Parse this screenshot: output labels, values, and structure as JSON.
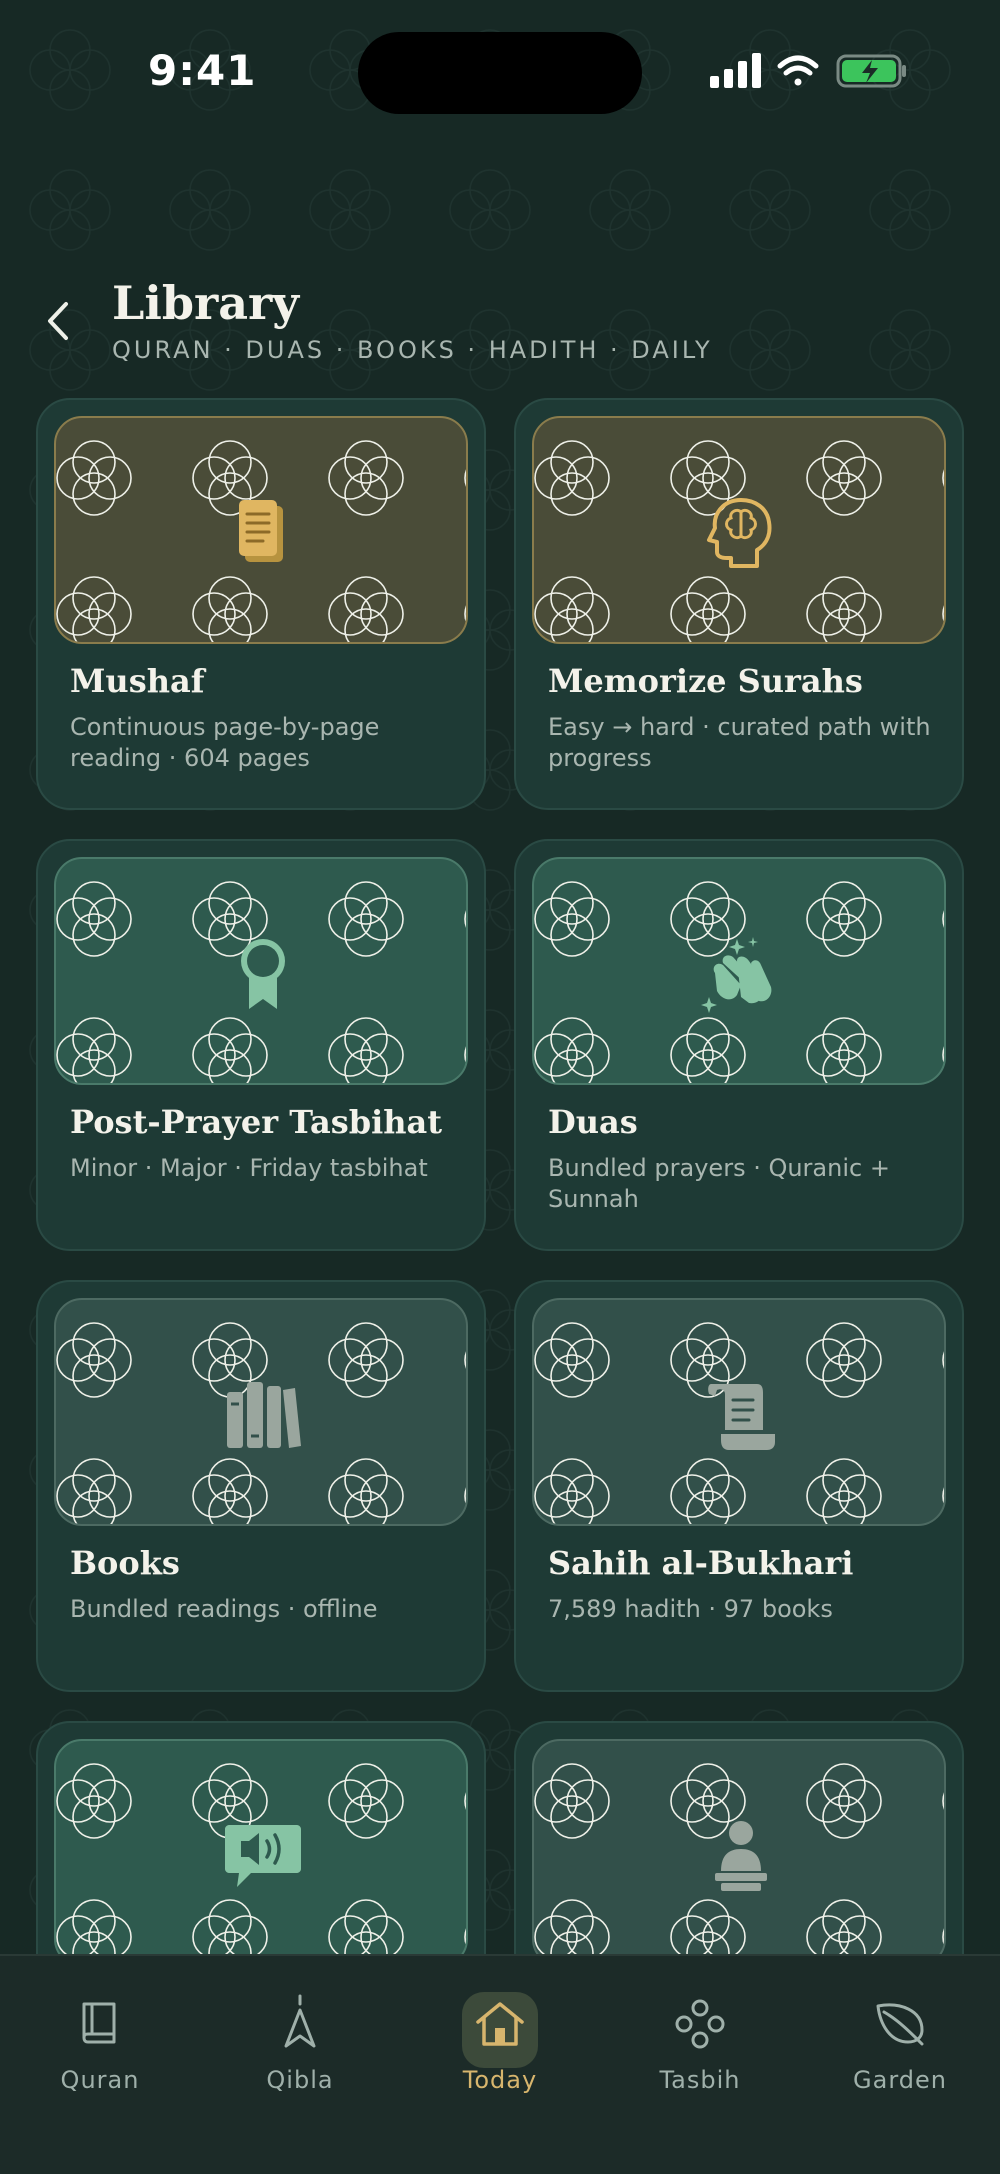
{
  "status_bar": {
    "time": "9:41"
  },
  "header": {
    "title": "Library",
    "subtitle": "QURAN · DUAS · BOOKS · HADITH · DAILY"
  },
  "cards": [
    {
      "title": "Mushaf",
      "description": "Continuous page-by-page reading · 604 pages",
      "icon": "document-icon",
      "theme": "gold"
    },
    {
      "title": "Memorize Surahs",
      "description": "Easy → hard · curated path with progress",
      "icon": "brain-icon",
      "theme": "gold"
    },
    {
      "title": "Post-Prayer Tasbihat",
      "description": "Minor · Major · Friday tasbihat",
      "icon": "ribbon-icon",
      "theme": "green"
    },
    {
      "title": "Duas",
      "description": "Bundled prayers · Quranic + Sunnah",
      "icon": "praying-hands-icon",
      "theme": "green"
    },
    {
      "title": "Books",
      "description": "Bundled readings · offline",
      "icon": "books-icon",
      "theme": "grey"
    },
    {
      "title": "Sahih al-Bukhari",
      "description": "7,589 hadith · 97 books",
      "icon": "scroll-icon",
      "theme": "grey"
    },
    {
      "title": "",
      "description": "",
      "icon": "speaker-bubble-icon",
      "theme": "green"
    },
    {
      "title": "",
      "description": "",
      "icon": "person-lectern-icon",
      "theme": "grey"
    }
  ],
  "tabs": [
    {
      "label": "Quran",
      "icon": "book-icon",
      "active": false
    },
    {
      "label": "Qibla",
      "icon": "compass-arrow-icon",
      "active": false
    },
    {
      "label": "Today",
      "icon": "home-icon",
      "active": true
    },
    {
      "label": "Tasbih",
      "icon": "beads-icon",
      "active": false
    },
    {
      "label": "Garden",
      "icon": "leaf-icon",
      "active": false
    }
  ],
  "colors": {
    "accent": "#d7b56d",
    "background": "#172925",
    "card": "#1e3a35",
    "text_secondary": "#a9b6b0"
  }
}
